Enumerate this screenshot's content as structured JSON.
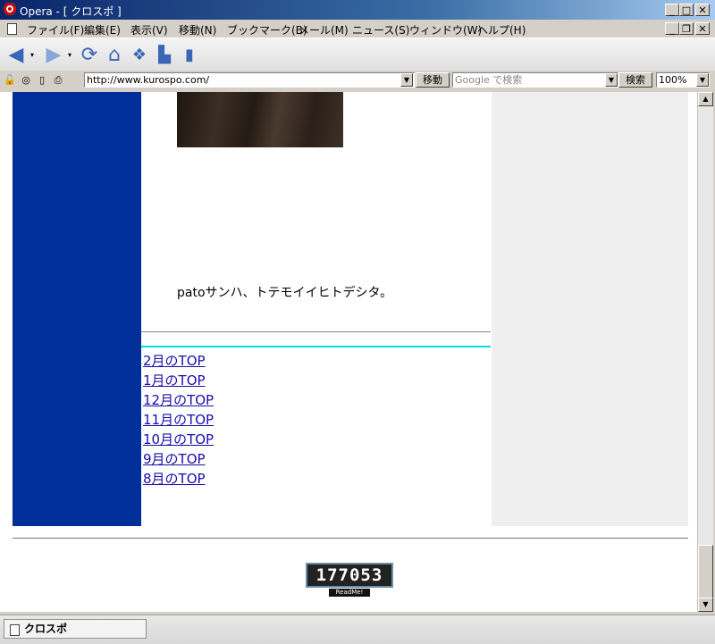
{
  "window": {
    "title": "Opera - [ クロスポ ]",
    "controls": {
      "minimize": "_",
      "maximize": "□",
      "close": "✕",
      "restore": "❐"
    }
  },
  "menubar": {
    "items": [
      "ファイル(F)",
      "編集(E)",
      "表示(V)",
      "移動(N)",
      "ブックマーク(B)",
      "メール(M)",
      "ニュース(S)",
      "ウィンドウ(W)",
      "ヘルプ(H)"
    ]
  },
  "toolbar": {
    "icons": [
      "back-icon",
      "forward-icon",
      "reload-icon",
      "home-icon",
      "hotlist-icon",
      "print-icon",
      "page-icon"
    ]
  },
  "addressbar": {
    "url": "http://www.kurospo.com/",
    "go_label": "移動",
    "search_placeholder": "Google で検索",
    "search_label": "検索",
    "zoom": "100%"
  },
  "page": {
    "caption": "patoサンハ、トテモイイヒトデシタ。",
    "links": [
      "2月のTOP",
      "1月のTOP",
      "12月のTOP",
      "11月のTOP",
      "10月のTOP",
      "9月のTOP",
      "8月のTOP"
    ],
    "counter": "177053",
    "counter_label": "ReadMe!"
  },
  "statusbar": {
    "tab_label": "クロスポ"
  },
  "colors": {
    "left_column": "#002f9a",
    "right_column": "#efefef",
    "link": "#1a0dab",
    "cyan_rule": "#00e0e0"
  }
}
